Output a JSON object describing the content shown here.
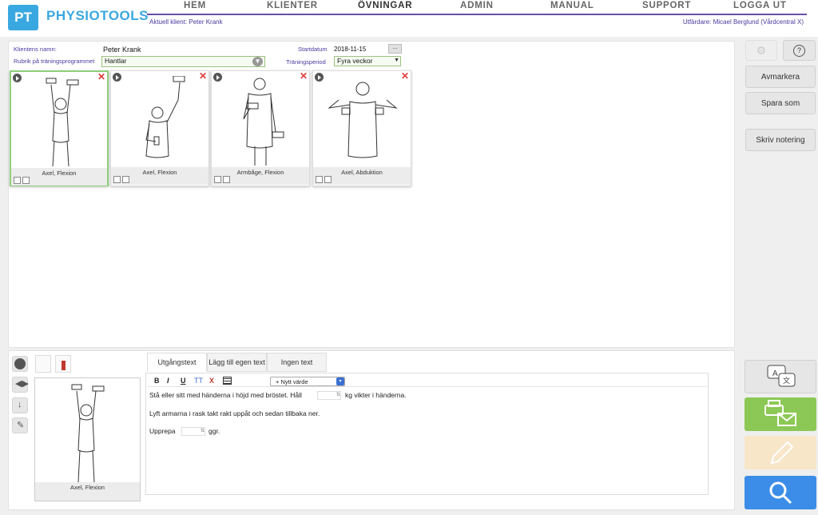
{
  "header": {
    "logo_mark": "PT",
    "logo_text": "PHYSIOTOOLS",
    "nav": [
      "HEM",
      "KLIENTER",
      "ÖVNINGAR",
      "ADMIN",
      "MANUAL",
      "SUPPORT",
      "LOGGA UT"
    ],
    "active_nav": "ÖVNINGAR",
    "current_client": "Aktuell klient: Peter Krank",
    "issuer": "Utfärdare: Micael Berglund (Vårdcentral X)"
  },
  "form": {
    "client_name_label": "Klientens namn:",
    "client_name": "Peter  Krank",
    "program_title_label": "Rubrik på träningsprogrammet",
    "program_title": "Hantlar",
    "start_date_label": "Startdatum",
    "start_date": "2018-11-15",
    "date_button": "...",
    "period_label": "Träningsperiod",
    "period": "Fyra veckor"
  },
  "exercises": [
    {
      "caption": "Axel, Flexion",
      "selected": true
    },
    {
      "caption": "Axel, Flexion",
      "selected": false
    },
    {
      "caption": "Armbåge, Flexion",
      "selected": false
    },
    {
      "caption": "Axel, Abduktion",
      "selected": false
    }
  ],
  "sidebar": {
    "unmark": "Avmarkera",
    "save_as": "Spara som",
    "write_note": "Skriv notering"
  },
  "editor": {
    "tabs": [
      "Utgångstext",
      "Lägg till egen text",
      "Ingen text"
    ],
    "toolbar": {
      "bold": "B",
      "italic": "I",
      "underline": "U",
      "size": "TT",
      "clear": "X"
    },
    "new_value": "+ Nytt värde",
    "line1_a": "Stå eller sitt med händerna i höjd med bröstet. Håll",
    "line1_b": "kg vikter i händerna.",
    "line2": "Lyft armarna i rask takt rakt uppåt och sedan tillbaka ner.",
    "line3_a": "Upprepa",
    "line3_b": "ggr.",
    "preview_caption": "Axel, Flexion"
  },
  "colors": {
    "brand": "#3aa8e0",
    "nav_accent": "#6a4fa3",
    "print_mail": "#8cc855",
    "edit": "#f7e6c8",
    "search": "#3b8de8"
  }
}
